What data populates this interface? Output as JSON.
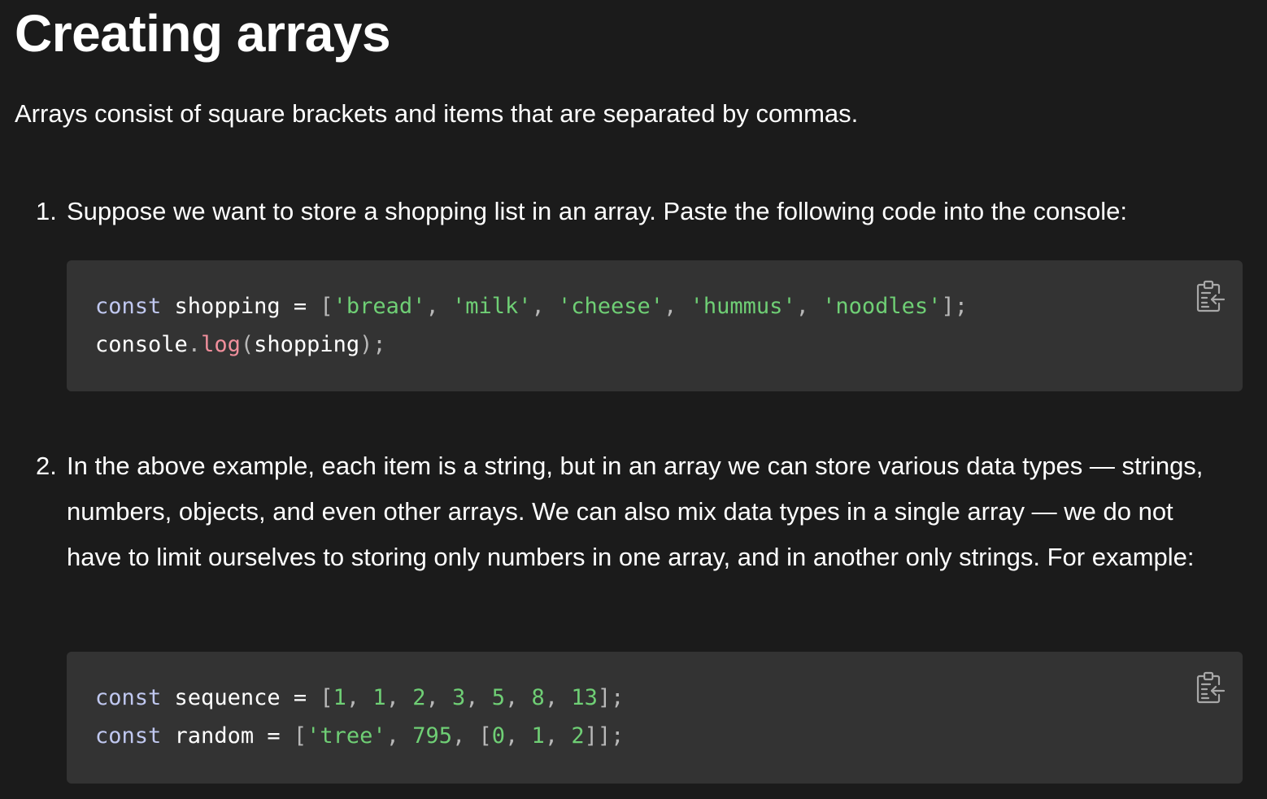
{
  "heading": "Creating arrays",
  "intro": "Arrays consist of square brackets and items that are separated by commas.",
  "steps": [
    {
      "number": "1.",
      "text": "Suppose we want to store a shopping list in an array. Paste the following code into the console:",
      "code": {
        "copy_icon": "copy-to-clipboard-icon",
        "lines": [
          [
            {
              "t": "const",
              "k": "kw"
            },
            {
              "t": " ",
              "k": "id"
            },
            {
              "t": "shopping",
              "k": "id"
            },
            {
              "t": " = ",
              "k": "id"
            },
            {
              "t": "[",
              "k": "punc"
            },
            {
              "t": "'bread'",
              "k": "str"
            },
            {
              "t": ", ",
              "k": "punc"
            },
            {
              "t": "'milk'",
              "k": "str"
            },
            {
              "t": ", ",
              "k": "punc"
            },
            {
              "t": "'cheese'",
              "k": "str"
            },
            {
              "t": ", ",
              "k": "punc"
            },
            {
              "t": "'hummus'",
              "k": "str"
            },
            {
              "t": ", ",
              "k": "punc"
            },
            {
              "t": "'noodles'",
              "k": "str"
            },
            {
              "t": "];",
              "k": "punc"
            }
          ],
          [
            {
              "t": "console",
              "k": "id"
            },
            {
              "t": ".",
              "k": "punc"
            },
            {
              "t": "log",
              "k": "fn"
            },
            {
              "t": "(",
              "k": "punc"
            },
            {
              "t": "shopping",
              "k": "id"
            },
            {
              "t": ");",
              "k": "punc"
            }
          ]
        ]
      }
    },
    {
      "number": "2.",
      "text": "In the above example, each item is a string, but in an array we can store various data types — strings, numbers, objects, and even other arrays. We can also mix data types in a single array — we do not have to limit ourselves to storing only numbers in one array, and in another only strings. For example:",
      "code": {
        "copy_icon": "copy-to-clipboard-icon",
        "lines": [
          [
            {
              "t": "const",
              "k": "kw"
            },
            {
              "t": " ",
              "k": "id"
            },
            {
              "t": "sequence",
              "k": "id"
            },
            {
              "t": " = ",
              "k": "id"
            },
            {
              "t": "[",
              "k": "punc"
            },
            {
              "t": "1",
              "k": "num"
            },
            {
              "t": ", ",
              "k": "punc"
            },
            {
              "t": "1",
              "k": "num"
            },
            {
              "t": ", ",
              "k": "punc"
            },
            {
              "t": "2",
              "k": "num"
            },
            {
              "t": ", ",
              "k": "punc"
            },
            {
              "t": "3",
              "k": "num"
            },
            {
              "t": ", ",
              "k": "punc"
            },
            {
              "t": "5",
              "k": "num"
            },
            {
              "t": ", ",
              "k": "punc"
            },
            {
              "t": "8",
              "k": "num"
            },
            {
              "t": ", ",
              "k": "punc"
            },
            {
              "t": "13",
              "k": "num"
            },
            {
              "t": "];",
              "k": "punc"
            }
          ],
          [
            {
              "t": "const",
              "k": "kw"
            },
            {
              "t": " ",
              "k": "id"
            },
            {
              "t": "random",
              "k": "id"
            },
            {
              "t": " = ",
              "k": "id"
            },
            {
              "t": "[",
              "k": "punc"
            },
            {
              "t": "'tree'",
              "k": "str"
            },
            {
              "t": ", ",
              "k": "punc"
            },
            {
              "t": "795",
              "k": "num"
            },
            {
              "t": ", ",
              "k": "punc"
            },
            {
              "t": "[",
              "k": "punc"
            },
            {
              "t": "0",
              "k": "num"
            },
            {
              "t": ", ",
              "k": "punc"
            },
            {
              "t": "1",
              "k": "num"
            },
            {
              "t": ", ",
              "k": "punc"
            },
            {
              "t": "2",
              "k": "num"
            },
            {
              "t": "]];",
              "k": "punc"
            }
          ]
        ]
      }
    }
  ],
  "colors": {
    "background": "#1b1b1b",
    "code_background": "#333333",
    "keyword": "#c0c8f0",
    "string": "#6fcf75",
    "number": "#6fcf75",
    "function": "#f08f9c",
    "punctuation": "#b8b8b8",
    "text": "#ffffff"
  }
}
